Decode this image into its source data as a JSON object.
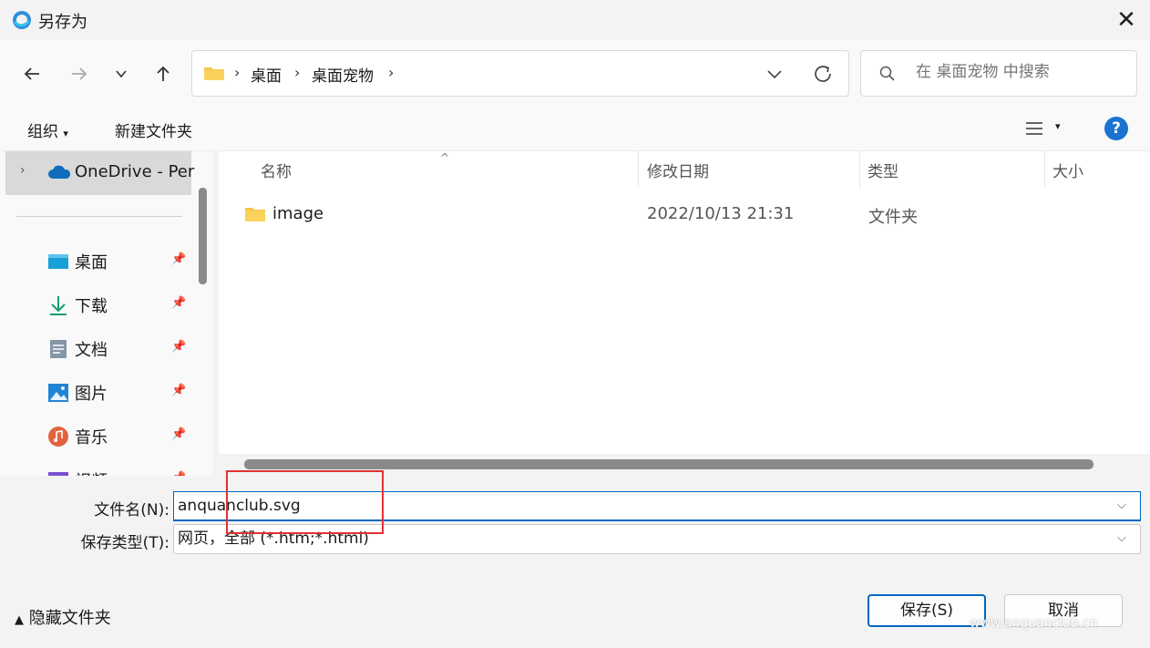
{
  "window": {
    "title": "另存为"
  },
  "navigation": {
    "breadcrumb": [
      "桌面",
      "桌面宠物"
    ],
    "search_placeholder": "在 桌面宠物 中搜索"
  },
  "commands": {
    "organize": "组织",
    "new_folder": "新建文件夹"
  },
  "sidebar": {
    "onedrive": "OneDrive - Per",
    "items": [
      {
        "label": "桌面",
        "icon": "desktop-icon"
      },
      {
        "label": "下载",
        "icon": "download-icon"
      },
      {
        "label": "文档",
        "icon": "documents-icon"
      },
      {
        "label": "图片",
        "icon": "pictures-icon"
      },
      {
        "label": "音乐",
        "icon": "music-icon"
      },
      {
        "label": "视频",
        "icon": "video-icon"
      }
    ]
  },
  "columns": [
    "名称",
    "修改日期",
    "类型",
    "大小"
  ],
  "files": [
    {
      "name": "image",
      "modified": "2022/10/13 21:31",
      "type": "文件夹"
    }
  ],
  "save": {
    "filename_label": "文件名(N):",
    "filename_value": "anquanclub.svg",
    "filetype_label": "保存类型(T):",
    "filetype_value": "网页，全部 (*.htm;*.html)"
  },
  "footer": {
    "hide_folders": "隐藏文件夹",
    "save_button": "保存(S)",
    "cancel_button": "取消"
  },
  "watermark": "www.anquanclub.cn",
  "colors": {
    "accent": "#0067c0",
    "highlight": "#e03232",
    "folder": "#f7c548"
  }
}
